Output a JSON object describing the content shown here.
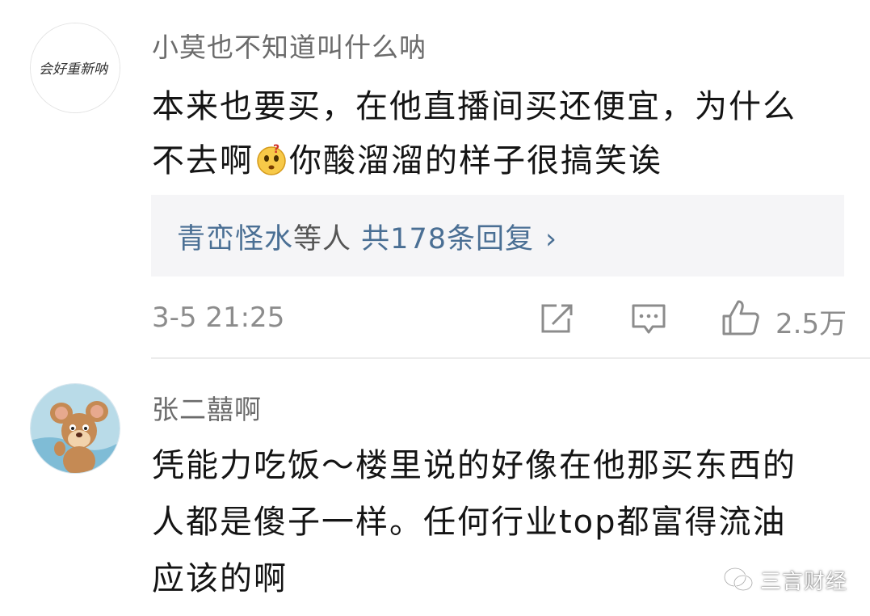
{
  "comments": [
    {
      "username": "小莫也不知道叫什么呐",
      "avatar_text": "会好重新呐 ",
      "lines": [
        "本来也要买，在他直播间买还便宜，为什么",
        "不去啊",
        "你酸溜溜的样子很搞笑诶"
      ],
      "emoji": "thinking-face-emoji",
      "replies": {
        "names": "青峦怪水",
        "mid": "等人",
        "count": "共178条回复",
        "arrow": "›"
      },
      "timestamp": "3-5 21:25",
      "like_count": "2.5万"
    },
    {
      "username": "张二囍啊",
      "lines": [
        "凭能力吃饭～楼里说的好像在他那买东西的",
        "人都是傻子一样。任何行业top都富得流油",
        "应该的啊"
      ]
    }
  ],
  "watermark": {
    "label": "三言财经",
    "icon": "wechat-icon"
  },
  "colors": {
    "link_blue": "#4a6f94",
    "muted_gray": "#8c8c8c",
    "reply_bg": "#f5f5f7"
  }
}
